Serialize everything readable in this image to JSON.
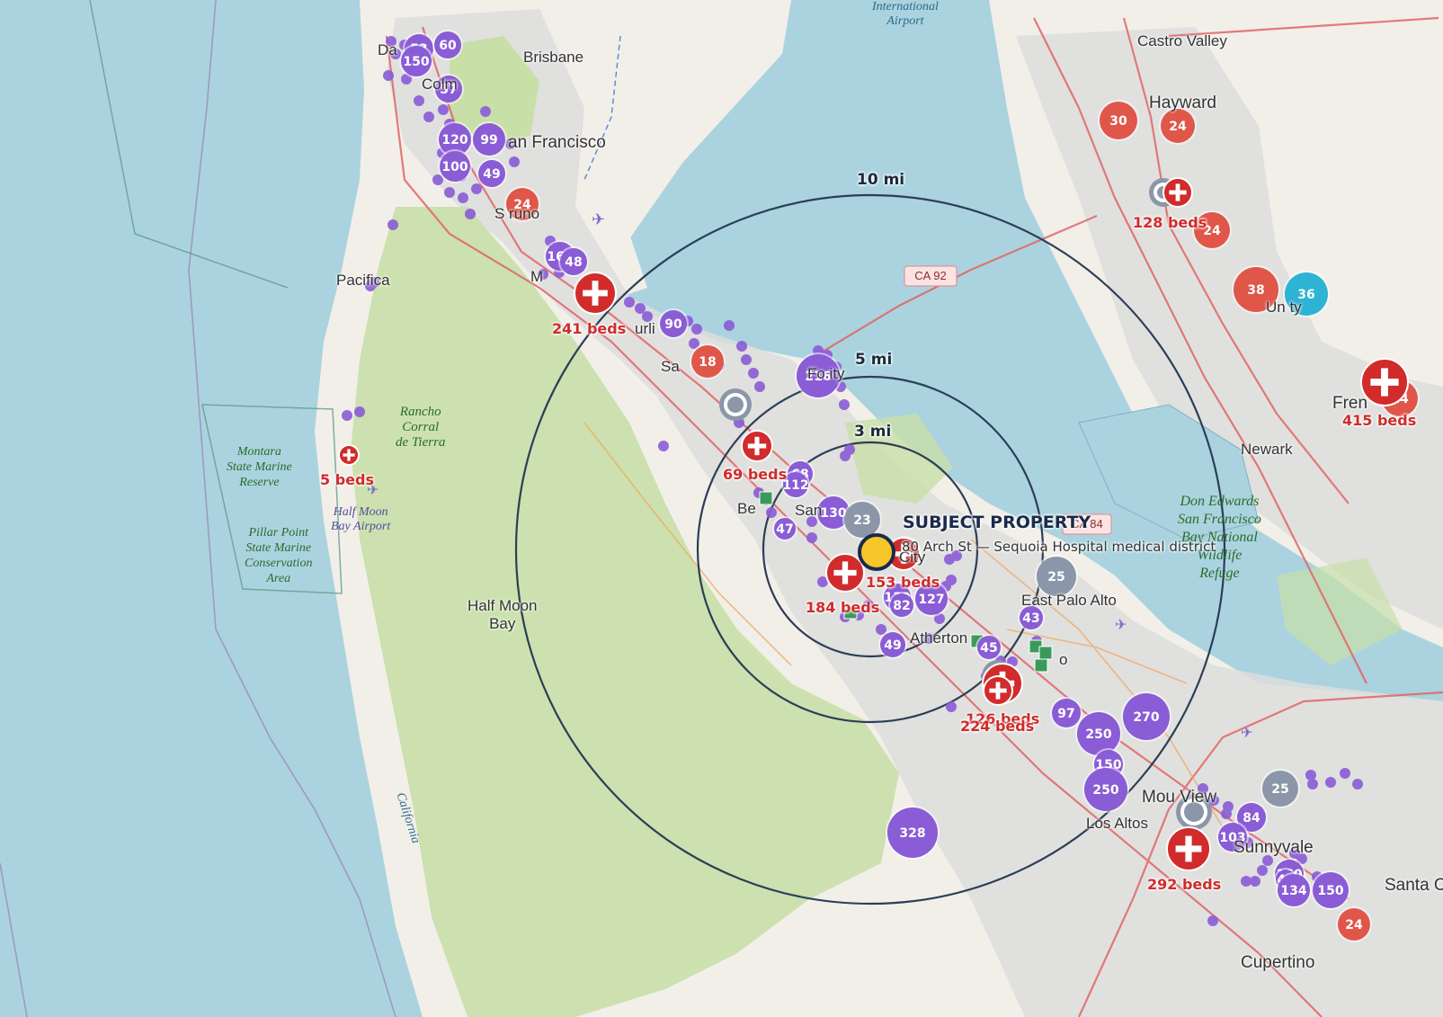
{
  "map": {
    "rings": [
      {
        "miles": 3,
        "label": "3 mi"
      },
      {
        "miles": 5,
        "label": "5 mi"
      },
      {
        "miles": 10,
        "label": "10 mi"
      }
    ],
    "subject": {
      "title": "SUBJECT PROPERTY",
      "subtitle": "80 Arch St — Sequoia Hospital medical district"
    },
    "colors": {
      "water": "#aad3df",
      "land": "#f2efe9",
      "urban": "#d9d9d9",
      "park": "#c8dfa8",
      "purple_cluster": "#8a5cd6",
      "red_cluster": "#e0574a",
      "gray_cluster": "#8b97a8",
      "teal_cluster": "#2fb3d4",
      "hospital_red": "#d12b2b",
      "green_square": "#3a9a5a",
      "subject_marker": "#f6c62b"
    },
    "places": {
      "daly": "Da",
      "colma": "Colm",
      "brisbane": "Brisbane",
      "sf": "an Francisco",
      "sanbruno": "S  runo",
      "millbrae": "M",
      "burlingame": "urli",
      "sanmateo": "Sa",
      "fostercity": "Fo   ity",
      "belmont": "Be",
      "sancarlos": "San",
      "redwood": "City",
      "atherton": "Atherton",
      "epa": "East Palo Alto",
      "paloalto": "o",
      "mtview": "Mou   View",
      "sunnyvale": "Sunnyvale",
      "losaltos": "Los Altos",
      "cupertino": "Cupertino",
      "santaclara": "Santa C",
      "pacifica": "Pacifica",
      "halfmoonbay": "Half Moon\nBay",
      "castro": "Castro Valley",
      "hayward": "Hayward",
      "unioncity": "Un   ty",
      "newark": "Newark",
      "fremont": "Fren",
      "airport": "International\nAirport"
    },
    "parks": {
      "montara": "Montara\nState Marine\nReserve",
      "rancho": "Rancho\nCorral\nde Tierra",
      "pillar": "Pillar Point\nState Marine\nConservation\nArea",
      "hmbairport": "Half Moon\nBay Airport",
      "donedwards": "Don Edwards\nSan Francisco\nBay National\nWildlife\nRefuge"
    },
    "water_labels": {
      "california": "California"
    },
    "road_badges": {
      "ca92": "CA 92",
      "rt84": "CA 84"
    },
    "clusters": [
      {
        "c": "purple",
        "n": "53"
      },
      {
        "c": "purple",
        "n": "60"
      },
      {
        "c": "purple",
        "n": "150"
      },
      {
        "c": "purple",
        "n": "57"
      },
      {
        "c": "purple",
        "n": "120"
      },
      {
        "c": "purple",
        "n": "99"
      },
      {
        "c": "purple",
        "n": "100"
      },
      {
        "c": "purple",
        "n": "49"
      },
      {
        "c": "red",
        "n": "24"
      },
      {
        "c": "purple",
        "n": "165"
      },
      {
        "c": "purple",
        "n": "48"
      },
      {
        "c": "purple",
        "n": "90"
      },
      {
        "c": "red",
        "n": "18"
      },
      {
        "c": "purple",
        "n": "216"
      },
      {
        "c": "purple",
        "n": "68"
      },
      {
        "c": "purple",
        "n": "112"
      },
      {
        "c": "purple",
        "n": "130"
      },
      {
        "c": "gray",
        "n": "23"
      },
      {
        "c": "purple",
        "n": "47"
      },
      {
        "c": "red",
        "n": "24"
      },
      {
        "c": "gray",
        "n": "25"
      },
      {
        "c": "purple",
        "n": "130"
      },
      {
        "c": "purple",
        "n": "127"
      },
      {
        "c": "purple",
        "n": "82"
      },
      {
        "c": "purple",
        "n": "43"
      },
      {
        "c": "purple",
        "n": "49"
      },
      {
        "c": "purple",
        "n": "45"
      },
      {
        "c": "purple",
        "n": "97"
      },
      {
        "c": "purple",
        "n": "270"
      },
      {
        "c": "purple",
        "n": "250"
      },
      {
        "c": "purple",
        "n": "150"
      },
      {
        "c": "purple",
        "n": "250"
      },
      {
        "c": "purple",
        "n": "328"
      },
      {
        "c": "gray",
        "n": "25"
      },
      {
        "c": "purple",
        "n": "84"
      },
      {
        "c": "purple",
        "n": "103"
      },
      {
        "c": "purple",
        "n": "160"
      },
      {
        "c": "purple",
        "n": "44"
      },
      {
        "c": "purple",
        "n": "134"
      },
      {
        "c": "purple",
        "n": "150"
      },
      {
        "c": "red",
        "n": "24"
      },
      {
        "c": "red",
        "n": "30"
      },
      {
        "c": "red",
        "n": "24"
      },
      {
        "c": "red",
        "n": "24"
      },
      {
        "c": "red",
        "n": "38"
      },
      {
        "c": "teal",
        "n": "36"
      },
      {
        "c": "red",
        "n": "24"
      }
    ],
    "hospitals": [
      {
        "beds": "241 beds"
      },
      {
        "beds": "5 beds"
      },
      {
        "beds": "69 beds"
      },
      {
        "beds": "184 beds"
      },
      {
        "beds": "153 beds"
      },
      {
        "beds": "126 beds"
      },
      {
        "beds": "224 beds"
      },
      {
        "beds": "292 beds"
      },
      {
        "beds": "128 beds"
      },
      {
        "beds": "415 beds"
      }
    ]
  }
}
